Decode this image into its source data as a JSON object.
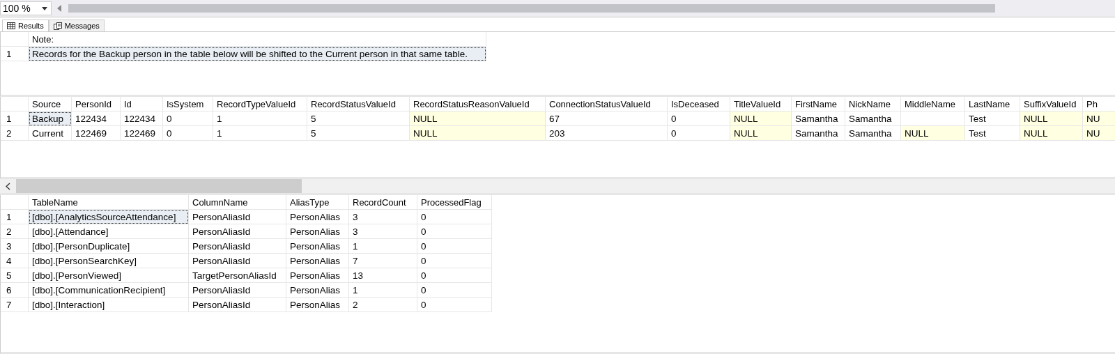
{
  "zoom": {
    "value": "100 %"
  },
  "tabs": [
    {
      "label": "Results",
      "kind": "grid",
      "selected": true
    },
    {
      "label": "Messages",
      "kind": "messages",
      "selected": false
    }
  ],
  "grids": [
    {
      "columns": [
        "Note:"
      ],
      "rows": [
        {
          "number": "1",
          "cells": [
            {
              "text": "Records for the Backup person in the table below will be shifted to the Current person in that same table.",
              "selected": true
            }
          ]
        }
      ]
    },
    {
      "columns": [
        "Source",
        "PersonId",
        "Id",
        "IsSystem",
        "RecordTypeValueId",
        "RecordStatusValueId",
        "RecordStatusReasonValueId",
        "ConnectionStatusValueId",
        "IsDeceased",
        "TitleValueId",
        "FirstName",
        "NickName",
        "MiddleName",
        "LastName",
        "SuffixValueId",
        "Ph"
      ],
      "rows": [
        {
          "number": "1",
          "cells": [
            {
              "text": "Backup",
              "null": false,
              "selected": true
            },
            {
              "text": "122434",
              "null": false,
              "selected": false
            },
            {
              "text": "122434",
              "null": false,
              "selected": false
            },
            {
              "text": "0",
              "null": false,
              "selected": false
            },
            {
              "text": "1",
              "null": false,
              "selected": false
            },
            {
              "text": "5",
              "null": false,
              "selected": false
            },
            {
              "text": "NULL",
              "null": true,
              "selected": false
            },
            {
              "text": "67",
              "null": false,
              "selected": false
            },
            {
              "text": "0",
              "null": false,
              "selected": false
            },
            {
              "text": "NULL",
              "null": true,
              "selected": false
            },
            {
              "text": "Samantha",
              "null": false,
              "selected": false
            },
            {
              "text": "Samantha",
              "null": false,
              "selected": false
            },
            {
              "null": false,
              "selected": false
            },
            {
              "text": "Test",
              "null": false,
              "selected": false
            },
            {
              "text": "NULL",
              "null": true,
              "selected": false
            },
            {
              "text": "NU",
              "null": true,
              "selected": false
            }
          ]
        },
        {
          "number": "2",
          "cells": [
            {
              "text": "Current",
              "null": false,
              "selected": false
            },
            {
              "text": "122469",
              "null": false,
              "selected": false
            },
            {
              "text": "122469",
              "null": false,
              "selected": false
            },
            {
              "text": "0",
              "null": false,
              "selected": false
            },
            {
              "text": "1",
              "null": false,
              "selected": false
            },
            {
              "text": "5",
              "null": false,
              "selected": false
            },
            {
              "text": "NULL",
              "null": true,
              "selected": false
            },
            {
              "text": "203",
              "null": false,
              "selected": false
            },
            {
              "text": "0",
              "null": false,
              "selected": false
            },
            {
              "text": "NULL",
              "null": true,
              "selected": false
            },
            {
              "text": "Samantha",
              "null": false,
              "selected": false
            },
            {
              "text": "Samantha",
              "null": false,
              "selected": false
            },
            {
              "text": "NULL",
              "null": true,
              "selected": false
            },
            {
              "text": "Test",
              "null": false,
              "selected": false
            },
            {
              "text": "NULL",
              "null": true,
              "selected": false
            },
            {
              "text": "NU",
              "null": true,
              "selected": false
            }
          ]
        }
      ]
    },
    {
      "columns": [
        "TableName",
        "ColumnName",
        "AliasType",
        "RecordCount",
        "ProcessedFlag"
      ],
      "rows": [
        {
          "number": "1",
          "cells": [
            {
              "text": "[dbo].[AnalyticsSourceAttendance]",
              "selected": true
            },
            {
              "text": "PersonAliasId",
              "selected": false
            },
            {
              "text": "PersonAlias",
              "selected": false
            },
            {
              "text": "3",
              "selected": false
            },
            {
              "text": "0",
              "selected": false
            }
          ]
        },
        {
          "number": "2",
          "cells": [
            {
              "text": "[dbo].[Attendance]",
              "selected": false
            },
            {
              "text": "PersonAliasId",
              "selected": false
            },
            {
              "text": "PersonAlias",
              "selected": false
            },
            {
              "text": "3",
              "selected": false
            },
            {
              "text": "0",
              "selected": false
            }
          ]
        },
        {
          "number": "3",
          "cells": [
            {
              "text": "[dbo].[PersonDuplicate]",
              "selected": false
            },
            {
              "text": "PersonAliasId",
              "selected": false
            },
            {
              "text": "PersonAlias",
              "selected": false
            },
            {
              "text": "1",
              "selected": false
            },
            {
              "text": "0",
              "selected": false
            }
          ]
        },
        {
          "number": "4",
          "cells": [
            {
              "text": "[dbo].[PersonSearchKey]",
              "selected": false
            },
            {
              "text": "PersonAliasId",
              "selected": false
            },
            {
              "text": "PersonAlias",
              "selected": false
            },
            {
              "text": "7",
              "selected": false
            },
            {
              "text": "0",
              "selected": false
            }
          ]
        },
        {
          "number": "5",
          "cells": [
            {
              "text": "[dbo].[PersonViewed]",
              "selected": false
            },
            {
              "text": "TargetPersonAliasId",
              "selected": false
            },
            {
              "text": "PersonAlias",
              "selected": false
            },
            {
              "text": "13",
              "selected": false
            },
            {
              "text": "0",
              "selected": false
            }
          ]
        },
        {
          "number": "6",
          "cells": [
            {
              "text": "[dbo].[CommunicationRecipient]",
              "selected": false
            },
            {
              "text": "PersonAliasId",
              "selected": false
            },
            {
              "text": "PersonAlias",
              "selected": false
            },
            {
              "text": "1",
              "selected": false
            },
            {
              "text": "0",
              "selected": false
            }
          ]
        },
        {
          "number": "7",
          "cells": [
            {
              "text": "[dbo].[Interaction]",
              "selected": false
            },
            {
              "text": "PersonAliasId",
              "selected": false
            },
            {
              "text": "PersonAlias",
              "selected": false
            },
            {
              "text": "2",
              "selected": false
            },
            {
              "text": "0",
              "selected": false
            }
          ]
        }
      ]
    }
  ]
}
